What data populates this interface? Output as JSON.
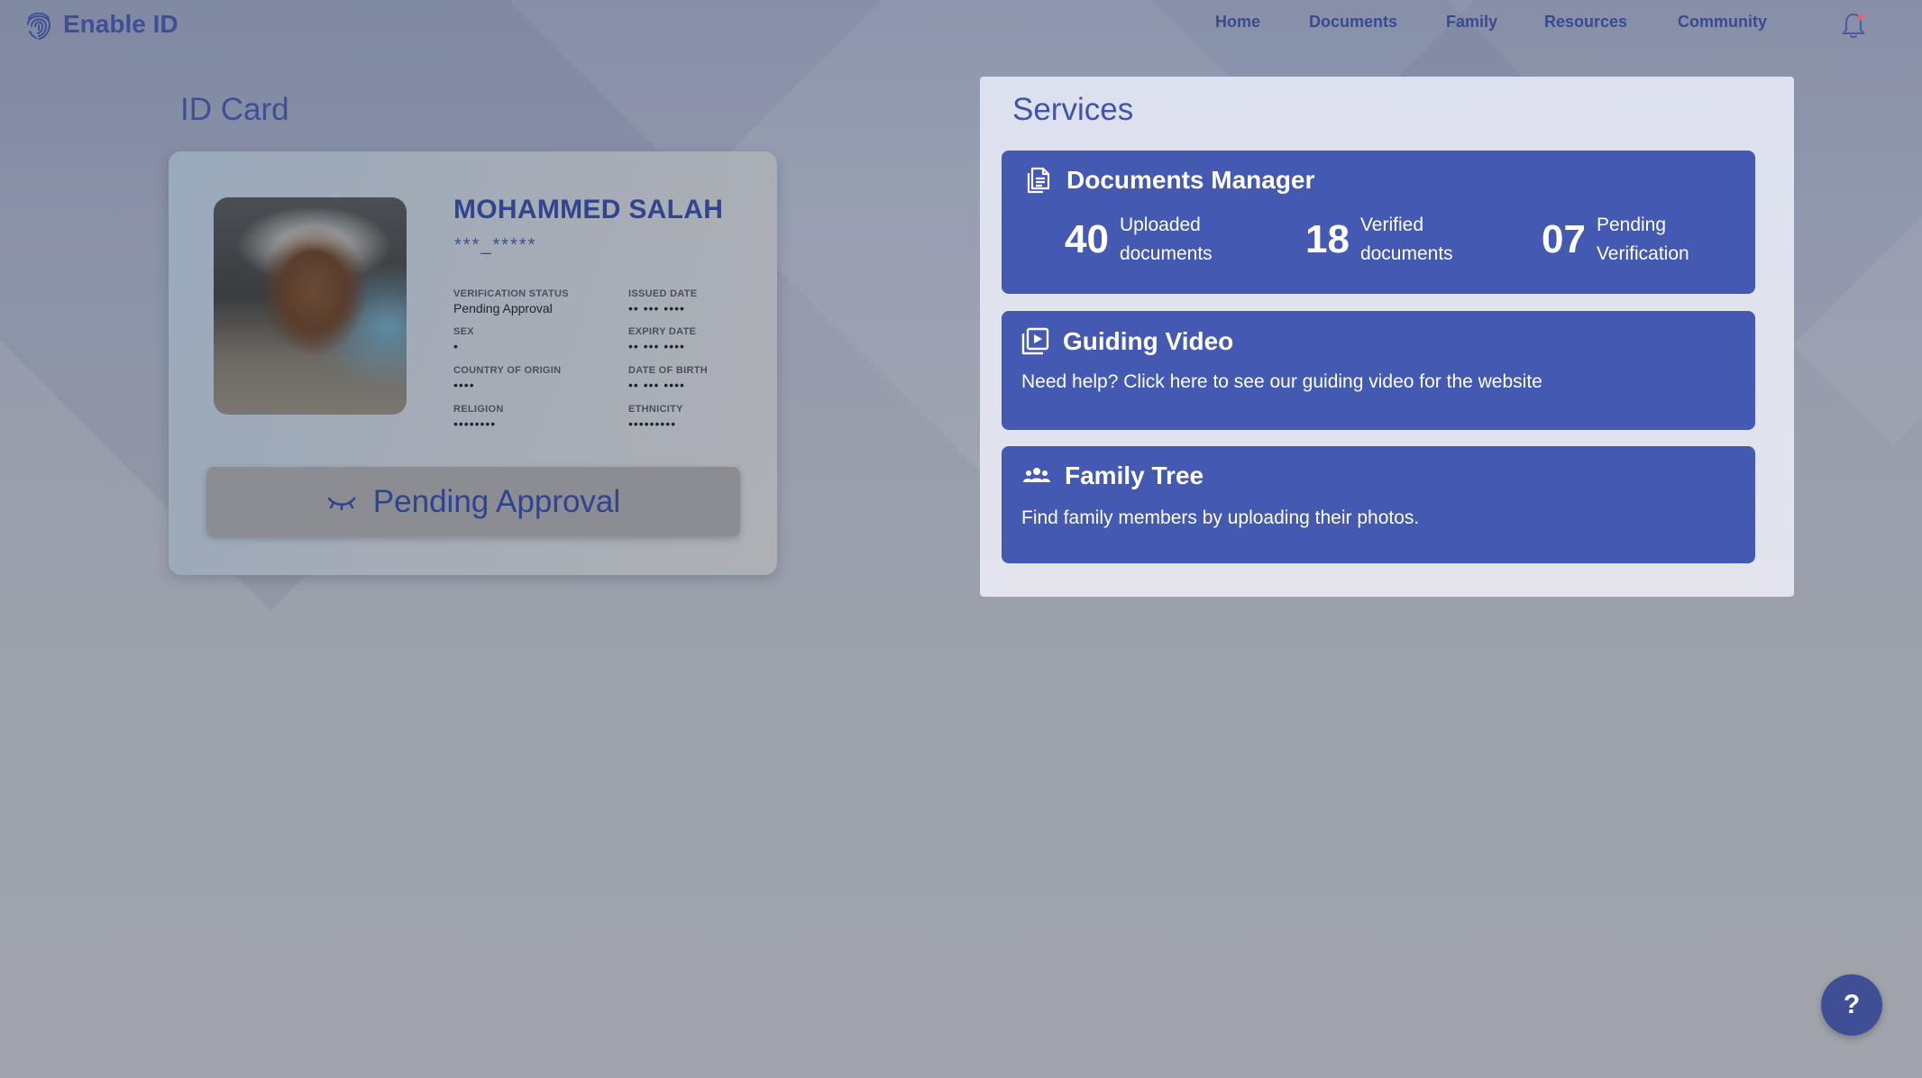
{
  "brand": {
    "name": "Enable ID"
  },
  "nav": {
    "items": [
      {
        "label": "Home"
      },
      {
        "label": "Documents"
      },
      {
        "label": "Family"
      },
      {
        "label": "Resources"
      },
      {
        "label": "Community"
      }
    ]
  },
  "id_card": {
    "section_title": "ID Card",
    "name": "MOHAMMED SALAH",
    "id_number": "***_*****",
    "fields": {
      "verification_status": {
        "label": "VERIFICATION STATUS",
        "value": "Pending Approval"
      },
      "issued_date": {
        "label": "ISSUED DATE",
        "value": "•• ••• ••••"
      },
      "sex": {
        "label": "SEX",
        "value": "•"
      },
      "expiry_date": {
        "label": "EXPIRY DATE",
        "value": "•• ••• ••••"
      },
      "country_of_origin": {
        "label": "COUNTRY OF ORIGIN",
        "value": "••••"
      },
      "date_of_birth": {
        "label": "DATE OF BIRTH",
        "value": "•• ••• ••••"
      },
      "religion": {
        "label": "RELIGION",
        "value": "••••••••"
      },
      "ethnicity": {
        "label": "ETHNICITY",
        "value": "•••••••••"
      }
    },
    "status_button": "Pending Approval"
  },
  "services": {
    "title": "Services",
    "documents_manager": {
      "title": "Documents Manager",
      "stats": [
        {
          "value": "40",
          "label": "Uploaded documents"
        },
        {
          "value": "18",
          "label": "Verified documents"
        },
        {
          "value": "07",
          "label": "Pending Verification"
        }
      ]
    },
    "guiding_video": {
      "title": "Guiding Video",
      "description": "Need help? Click here to see our guiding video for the website"
    },
    "family_tree": {
      "title": "Family Tree",
      "description": "Find family members by uploading their photos."
    }
  },
  "help_button": {
    "label": "?"
  },
  "colors": {
    "brand": "#3f4f96",
    "service_card": "#4459b1",
    "notification_dot": "#e06a6a"
  },
  "icons": {
    "logo": "fingerprint-icon",
    "notifications": "bell-icon",
    "pending": "closed-eye-icon",
    "documents": "documents-icon",
    "video": "video-play-icon",
    "family": "people-group-icon"
  }
}
